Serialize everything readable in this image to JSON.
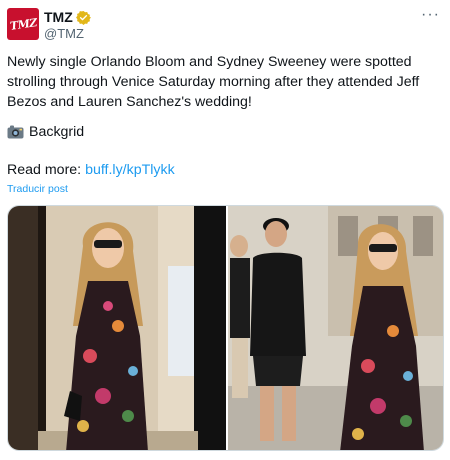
{
  "author": {
    "avatar_text": "TMZ",
    "display_name": "TMZ",
    "handle": "@TMZ",
    "verified_icon": "gold-verified-badge-icon"
  },
  "more_icon": "···",
  "post": {
    "text": "Newly single Orlando Bloom and Sydney Sweeney were spotted strolling through Venice Saturday morning after they attended Jeff Bezos and Lauren Sanchez's wedding!",
    "credit": "Backgrid",
    "read_more_label": "Read more:",
    "read_more_link": "buff.ly/kpTlykk",
    "translate_label": "Traducir post"
  },
  "media": {
    "photo_left": "woman-in-floral-dress-photo",
    "photo_right": "couple-walking-street-photo"
  },
  "colors": {
    "accent": "#1d9bf0",
    "brand": "#c8102e",
    "verified": "#e2b719"
  }
}
